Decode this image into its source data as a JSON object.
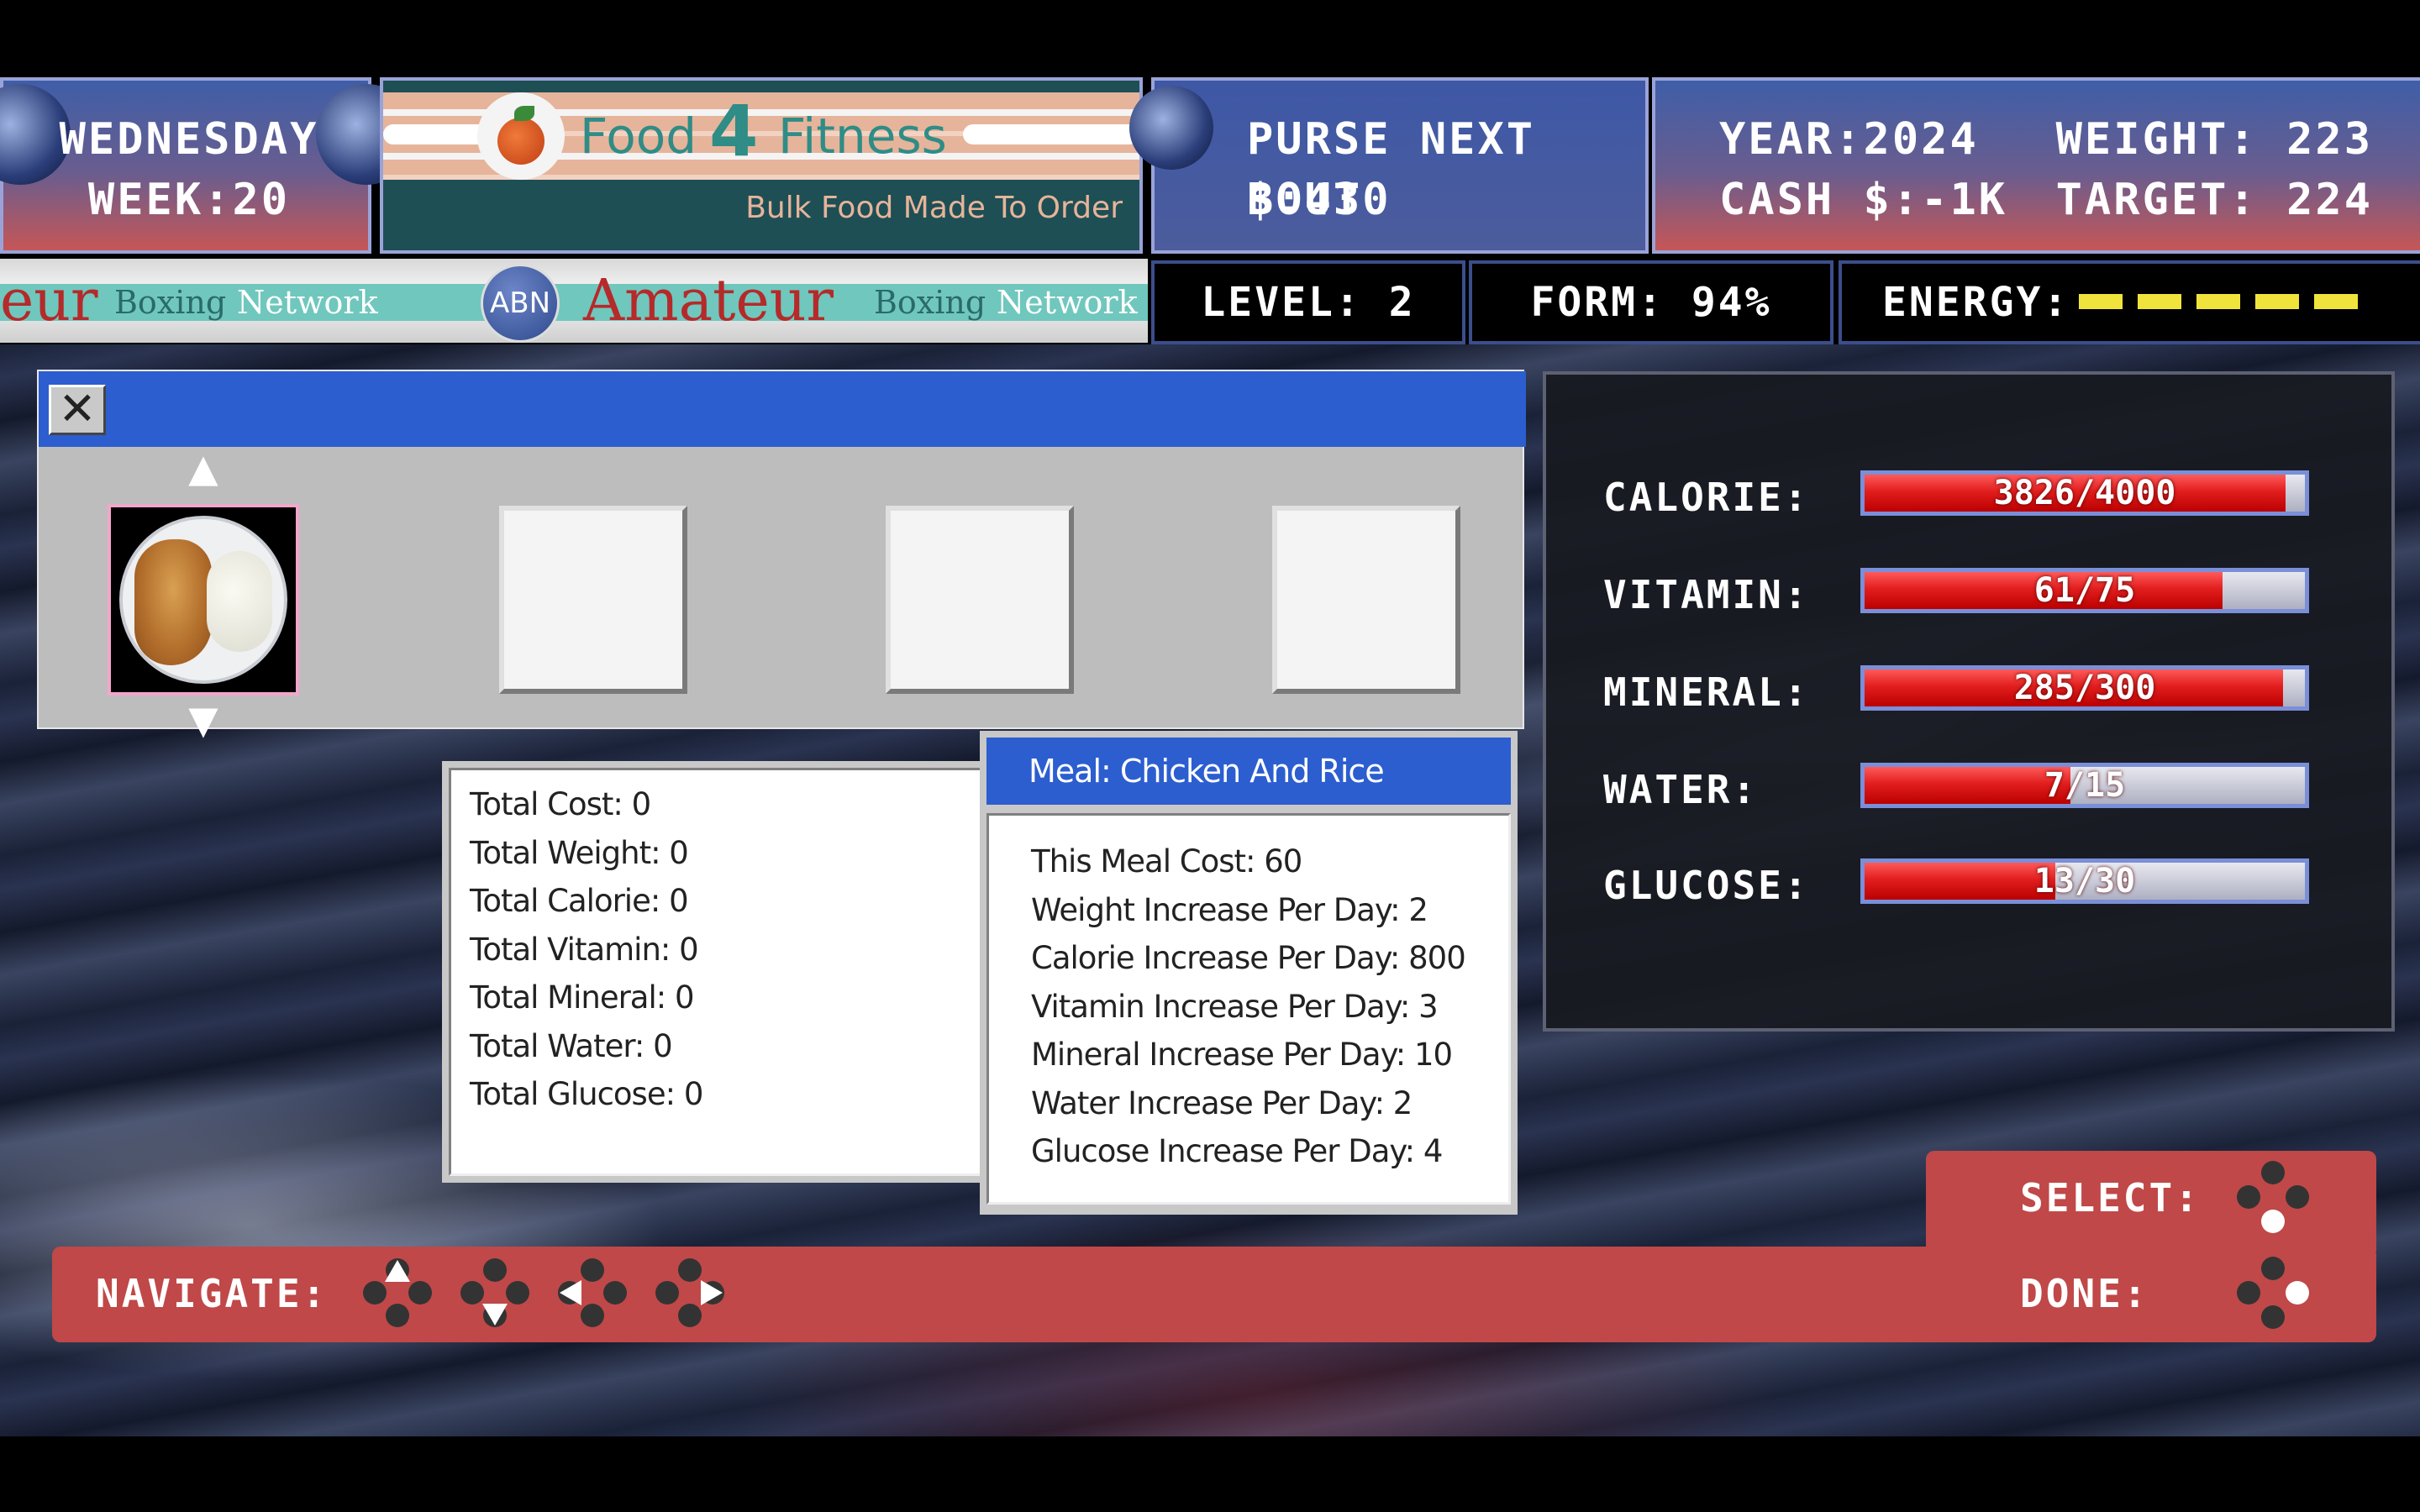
{
  "header": {
    "day": "WEDNESDAY",
    "week": "WEEK:20",
    "sponsor_number": "4",
    "sponsor_word1": "Food",
    "sponsor_word2": "Fitness",
    "sponsor_tagline": "Bulk Food Made To Order",
    "purse_label": "PURSE NEXT BOUT",
    "purse_value": "$:430",
    "year": "YEAR:2024",
    "cash": "CASH $:-1K",
    "weight": "WEIGHT: 223",
    "target": "TARGET: 224"
  },
  "ticker": {
    "left_fragment": "eur",
    "boxing1": "Boxing",
    "network1": "Network",
    "logo": "ABN",
    "amateur": "Amateur",
    "boxing2": "Boxing",
    "network2": "Network"
  },
  "stats": {
    "level": "LEVEL: 2",
    "form": "FORM: 94%",
    "energy_label": "ENERGY:",
    "energy_pips": 5,
    "energy_color": "#f0e43c"
  },
  "inventory": {
    "close_glyph": "✕",
    "up_glyph": "▲",
    "down_glyph": "▼",
    "slots": [
      "chicken-and-rice",
      "empty",
      "empty",
      "empty"
    ]
  },
  "totals": {
    "lines": [
      "Total Cost: 0",
      "Total Weight: 0",
      "Total Calorie: 0",
      "Total Vitamin: 0",
      "Total Mineral: 0",
      "Total Water: 0",
      "Total Glucose: 0"
    ]
  },
  "meal": {
    "title": "Meal: Chicken And Rice",
    "lines": [
      "This Meal Cost: 60",
      "Weight Increase Per Day: 2",
      "Calorie Increase Per Day: 800",
      "Vitamin Increase Per Day: 3",
      "Mineral Increase Per Day: 10",
      "Water Increase Per Day: 2",
      "Glucose Increase Per Day: 4"
    ]
  },
  "nutrients": [
    {
      "label": "CALORIE:",
      "value": "3826/4000",
      "fraction": 0.9565
    },
    {
      "label": "VITAMIN:",
      "value": "61/75",
      "fraction": 0.8133
    },
    {
      "label": "MINERAL:",
      "value": "285/300",
      "fraction": 0.95
    },
    {
      "label": "WATER:",
      "value": "7/15",
      "fraction": 0.4667
    },
    {
      "label": "GLUCOSE:",
      "value": "13/30",
      "fraction": 0.4333
    }
  ],
  "controls": {
    "navigate": "NAVIGATE:",
    "select": "SELECT:",
    "done": "DONE:"
  },
  "colors": {
    "title_blue": "#2c5ed0",
    "bar_red": "#e21e1e",
    "control_red": "#c04848"
  }
}
